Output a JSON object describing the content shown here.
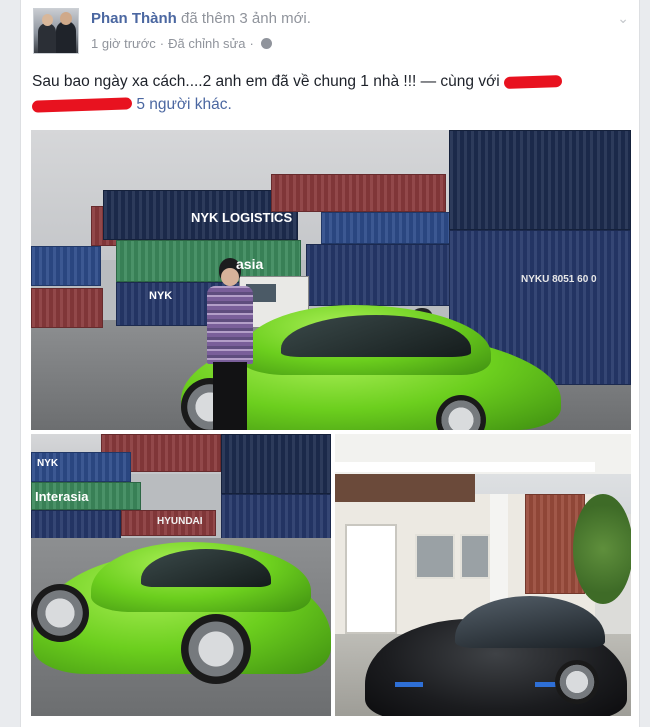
{
  "post": {
    "author": "Phan Thành",
    "action": "đã thêm 3 ảnh mới.",
    "time": "1 giờ trước",
    "separator": "·",
    "edited": "Đã chỉnh sửa",
    "privacy_icon": "globe-icon",
    "status_text": "Sau bao ngày xa cách....2 anh em đã về chung 1 nhà !!! — cùng với",
    "others": "5 người khác."
  },
  "photos": {
    "main": {
      "container_labels": [
        "NYK LOGISTICS",
        "asia",
        "NYK",
        "NYKU 8051 60 0"
      ]
    },
    "left": {
      "container_labels": [
        "NYK",
        "Interasia",
        "HYUNDAI"
      ]
    }
  },
  "colors": {
    "link": "#4b67a1",
    "meta": "#90949c",
    "redaction": "#e8121f",
    "car_green": "#6ccf1e"
  }
}
